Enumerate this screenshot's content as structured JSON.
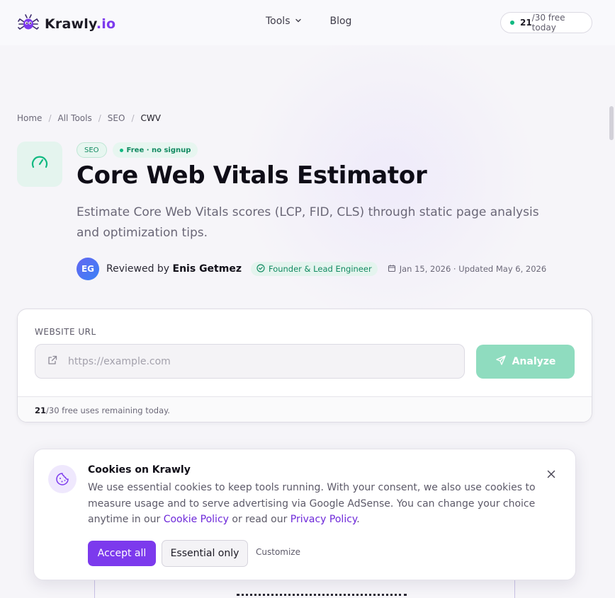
{
  "header": {
    "logo_name": "Krawly",
    "logo_tld": ".io",
    "nav": {
      "tools_label": "Tools",
      "blog_label": "Blog"
    },
    "quota": {
      "used": "21",
      "rest": "/30 free today"
    }
  },
  "breadcrumb": [
    "Home",
    "All Tools",
    "SEO",
    "CWV"
  ],
  "hero": {
    "tag_category": "SEO",
    "tag_free": "Free · no signup",
    "title": "Core Web Vitals Estimator",
    "description": "Estimate Core Web Vitals scores (LCP, FID, CLS) through static page analysis and optimization tips.",
    "reviewer": {
      "initials": "EG",
      "prefix": "Reviewed by",
      "name": "Enis Getmez",
      "role": "Founder & Lead Engineer",
      "dates": "Jan 15, 2026 · Updated May 6, 2026"
    }
  },
  "form": {
    "label": "WEBSITE URL",
    "placeholder": "https://example.com",
    "value": "",
    "analyze_label": "Analyze",
    "footer_count": "21",
    "footer_rest": "/30 free uses remaining today."
  },
  "cookie": {
    "title": "Cookies on Krawly",
    "body": "We use essential cookies to keep tools running. With your consent, we also use cookies to measure usage and to serve advertising via Google AdSense. You can change your choice anytime in our",
    "cookie_policy": "Cookie Policy",
    "or_text": " or read our ",
    "privacy_policy": "Privacy Policy",
    "end": ".",
    "accept_label": "Accept all",
    "essential_label": "Essential only",
    "customize_label": "Customize"
  },
  "colors": {
    "accent": "#7c3aed",
    "brand_green": "#10b981",
    "analyze_disabled": "#8fdcbf"
  },
  "icons": [
    "spider-logo-icon",
    "chevron-down-icon",
    "gauge-icon",
    "check-circle-icon",
    "calendar-icon",
    "external-link-icon",
    "send-icon",
    "cookie-icon",
    "close-icon"
  ]
}
